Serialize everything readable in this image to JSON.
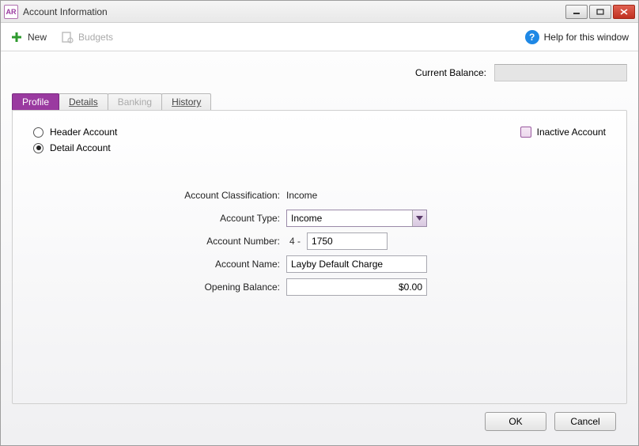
{
  "window": {
    "title": "Account Information",
    "app_badge": "AR"
  },
  "toolbar": {
    "new_label": "New",
    "budgets_label": "Budgets",
    "help_label": "Help for this window"
  },
  "balance": {
    "label": "Current Balance:",
    "value": ""
  },
  "tabs": {
    "profile": "Profile",
    "details": "Details",
    "banking": "Banking",
    "history": "History"
  },
  "radios": {
    "header": "Header Account",
    "detail": "Detail Account",
    "selected": "detail"
  },
  "inactive": {
    "label": "Inactive Account",
    "checked": false
  },
  "form": {
    "classification_label": "Account Classification:",
    "classification_value": "Income",
    "type_label": "Account Type:",
    "type_value": "Income",
    "number_label": "Account Number:",
    "number_prefix": "4 -",
    "number_value": "1750",
    "name_label": "Account Name:",
    "name_value": "Layby Default Charge",
    "opening_label": "Opening Balance:",
    "opening_value": "$0.00"
  },
  "buttons": {
    "ok": "OK",
    "cancel": "Cancel"
  }
}
